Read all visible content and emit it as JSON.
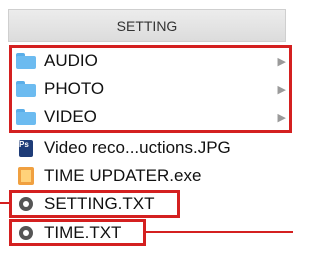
{
  "header": {
    "title": "SETTING"
  },
  "folders": [
    {
      "label": "AUDIO",
      "icon": "folder-icon"
    },
    {
      "label": "PHOTO",
      "icon": "folder-icon"
    },
    {
      "label": "VIDEO",
      "icon": "folder-icon"
    }
  ],
  "files": [
    {
      "label": "Video reco...uctions.JPG",
      "icon": "jpg-file-icon"
    },
    {
      "label": "TIME UPDATER.exe",
      "icon": "exe-file-icon"
    },
    {
      "label": "SETTING.TXT",
      "icon": "txt-file-icon"
    },
    {
      "label": "TIME.TXT",
      "icon": "txt-file-icon"
    }
  ],
  "colors": {
    "highlight": "#d42020",
    "folder": "#6cbbf0",
    "header_bg": "#e4e4e4"
  }
}
